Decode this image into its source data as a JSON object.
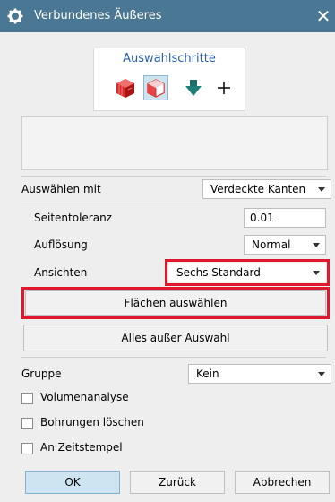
{
  "window": {
    "title": "Verbundenes Äußeres",
    "close_glyph": "✕"
  },
  "selection_steps": {
    "label": "Auswahlschritte",
    "icons": [
      "solid-body-icon",
      "faces-body-icon",
      "down-arrow-icon",
      "plus-icon"
    ]
  },
  "select_with": {
    "label": "Auswählen mit",
    "value": "Verdeckte Kanten"
  },
  "side_tolerance": {
    "label": "Seitentoleranz",
    "value": "0.01"
  },
  "resolution": {
    "label": "Auflösung",
    "value": "Normal"
  },
  "views": {
    "label": "Ansichten",
    "value": "Sechs Standard"
  },
  "buttons": {
    "select_faces": "Flächen auswählen",
    "all_except_selection": "Alles außer Auswahl"
  },
  "group": {
    "label": "Gruppe",
    "value": "Kein"
  },
  "checkboxes": [
    {
      "label": "Volumenanalyse",
      "checked": false
    },
    {
      "label": "Bohrungen löschen",
      "checked": false
    },
    {
      "label": "An Zeitstempel",
      "checked": false
    }
  ],
  "footer": {
    "ok": "OK",
    "back": "Zurück",
    "cancel": "Abbrechen"
  },
  "colors": {
    "titlebar": "#4a7894",
    "highlight": "#e0182b",
    "accent_text": "#2a5db0"
  }
}
